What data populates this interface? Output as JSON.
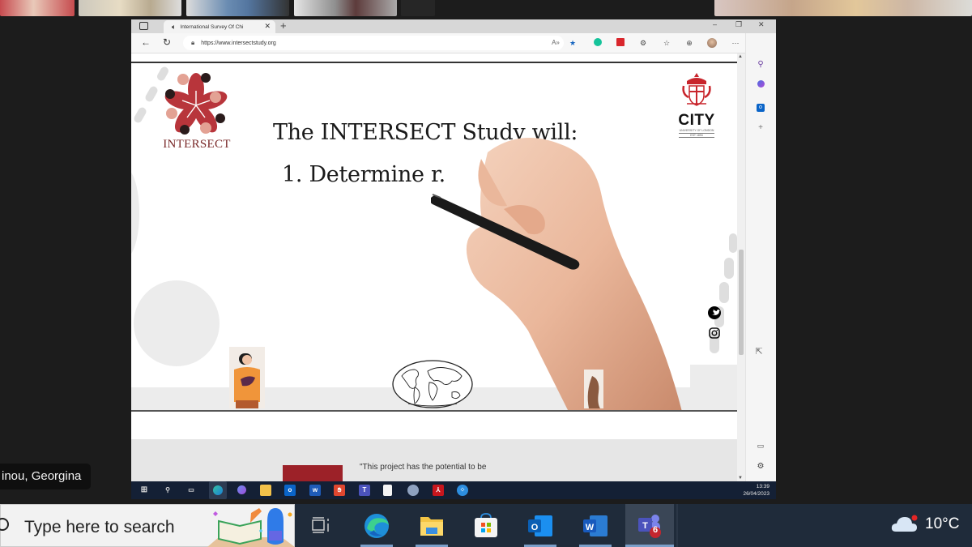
{
  "meeting": {
    "participant_label": "inou, Georgina",
    "video_tiles": [
      {
        "name": "participant-1",
        "color": "#b9484a"
      },
      {
        "name": "participant-2",
        "color": "#cfc4ad"
      },
      {
        "name": "participant-3",
        "color": "#5f7ea2"
      },
      {
        "name": "participant-4",
        "color": "#9a9a9a"
      },
      {
        "name": "participant-5",
        "color": "#2a2a2a"
      },
      {
        "name": "participant-6",
        "color": "#c9b29a"
      }
    ]
  },
  "browser": {
    "tab_title": "International Survey Of Chi",
    "url": "https://www.intersectstudy.org",
    "window_controls": {
      "minimize": "–",
      "restore": "❐",
      "close": "✕"
    },
    "nav": {
      "back": "←",
      "refresh": "↻"
    },
    "toolbar_icons": [
      "read-aloud-icon",
      "favorite-star-icon",
      "grammarly-icon",
      "extension-red-icon",
      "extensions-icon",
      "favorites-icon",
      "collections-icon",
      "profile-avatar",
      "more-icon",
      "bing-icon"
    ],
    "sidebar_icons": [
      "search-icon",
      "copilot-icon",
      "outlook-icon",
      "add-icon",
      "sidebar-toggle-icon",
      "settings-icon"
    ]
  },
  "slide": {
    "logo_left_text": "INTERSECT",
    "logo_right": {
      "name": "CITY",
      "sub": "UNIVERSITY OF LONDON",
      "est": "EST 1894"
    },
    "headline": "The INTERSECT Study will:",
    "item1": "1. Determine r.",
    "social": [
      "twitter-icon",
      "instagram-icon"
    ]
  },
  "below": {
    "quote": "\"This project has the potential to be"
  },
  "inner_taskbar": {
    "time": "13:39",
    "date": "26/04/2023",
    "apps": [
      "start",
      "search",
      "task-view",
      "edge",
      "copilot",
      "file-explorer",
      "outlook",
      "word",
      "app-red",
      "teams",
      "file",
      "network",
      "acrobat",
      "app-blue"
    ]
  },
  "taskbar": {
    "search_placeholder": "Type here to search",
    "teams_badge": "6",
    "weather": "10°C",
    "apps": [
      "edge",
      "file-explorer",
      "microsoft-store",
      "outlook",
      "word",
      "teams"
    ],
    "colors": {
      "accent": "#9c2128",
      "taskbar": "#1f2b3a"
    }
  }
}
